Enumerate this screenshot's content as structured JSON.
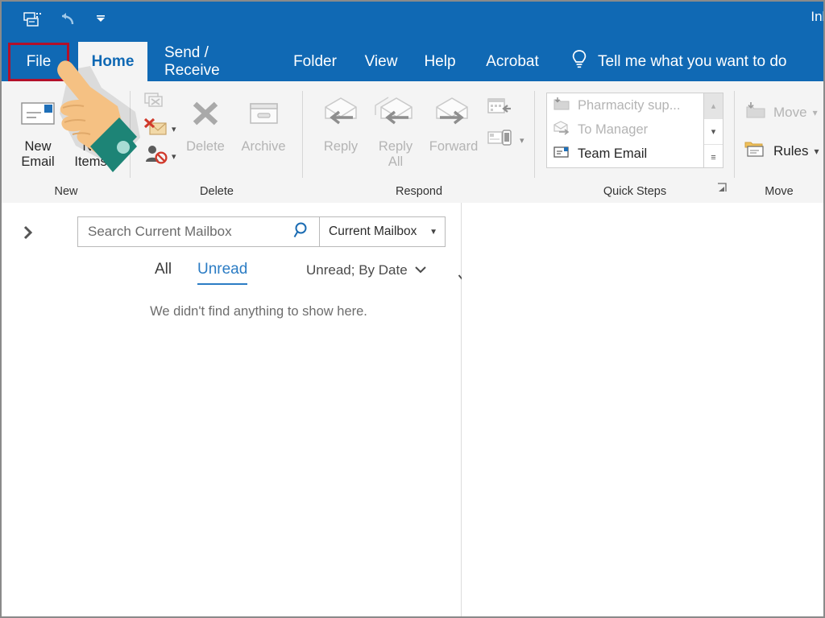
{
  "window": {
    "title": "Inb",
    "accent_color": "#1069b4",
    "highlight_color": "#b3102a"
  },
  "quick_access_toolbar": {
    "items": [
      {
        "name": "send-receive-all-folders",
        "tooltip": "Send/Receive All Folders"
      },
      {
        "name": "undo",
        "tooltip": "Undo"
      },
      {
        "name": "customize-quick-access-toolbar",
        "tooltip": "Customize Quick Access Toolbar"
      }
    ]
  },
  "tabs": [
    {
      "label": "File",
      "active": false
    },
    {
      "label": "Home",
      "active": true
    },
    {
      "label": "Send / Receive",
      "active": false
    },
    {
      "label": "Folder",
      "active": false
    },
    {
      "label": "View",
      "active": false
    },
    {
      "label": "Help",
      "active": false
    },
    {
      "label": "Acrobat",
      "active": false
    }
  ],
  "tell_me": {
    "label": "Tell me what you want to do",
    "icon": "lightbulb-icon"
  },
  "ribbon": {
    "groups": [
      {
        "label": "New",
        "buttons": [
          {
            "label_line1": "New",
            "label_line2": "Email",
            "icon": "new-email-icon",
            "disabled": false
          },
          {
            "label_line1": "New",
            "label_line2": "Items",
            "icon": "new-items-icon",
            "disabled": false,
            "has_dropdown": true
          }
        ]
      },
      {
        "label": "Delete",
        "small_buttons": [
          {
            "name": "ignore",
            "icon": "ignore-icon",
            "disabled": true
          },
          {
            "name": "junk",
            "icon": "junk-envelope-icon",
            "disabled": false,
            "has_dropdown": true
          },
          {
            "name": "block-sender",
            "icon": "block-sender-icon",
            "disabled": false,
            "has_dropdown": true
          }
        ],
        "buttons": [
          {
            "label_line1": "Delete",
            "label_line2": "",
            "icon": "delete-x-icon",
            "disabled": true
          },
          {
            "label_line1": "Archive",
            "label_line2": "",
            "icon": "archive-box-icon",
            "disabled": true
          }
        ]
      },
      {
        "label": "Respond",
        "buttons": [
          {
            "label_line1": "Reply",
            "label_line2": "",
            "icon": "reply-icon",
            "disabled": true
          },
          {
            "label_line1": "Reply",
            "label_line2": "All",
            "icon": "reply-all-icon",
            "disabled": true
          },
          {
            "label_line1": "Forward",
            "label_line2": "",
            "icon": "forward-icon",
            "disabled": true
          }
        ],
        "small_buttons": [
          {
            "name": "meeting",
            "icon": "meeting-icon",
            "disabled": true
          },
          {
            "name": "more-respond",
            "icon": "reply-device-icon",
            "disabled": true,
            "has_dropdown": true
          }
        ]
      },
      {
        "label": "Quick Steps",
        "gallery": [
          {
            "label": "Pharmacity sup...",
            "icon": "move-to-folder-icon",
            "disabled": true
          },
          {
            "label": "To Manager",
            "icon": "to-manager-icon",
            "disabled": true
          },
          {
            "label": "Team Email",
            "icon": "team-email-icon",
            "disabled": false
          }
        ],
        "scroll_buttons": [
          {
            "name": "scroll-up",
            "glyph": "▴",
            "disabled": true
          },
          {
            "name": "scroll-down",
            "glyph": "▾",
            "disabled": false
          },
          {
            "name": "more-quick-steps",
            "glyph": "≡",
            "disabled": false
          }
        ],
        "has_dialog_launcher": true
      },
      {
        "label": "Move",
        "small_buttons": [
          {
            "label": "Move",
            "icon": "move-folder-icon",
            "disabled": true,
            "has_dropdown": true
          },
          {
            "label": "Rules",
            "icon": "rules-icon",
            "disabled": false,
            "has_dropdown": true
          }
        ]
      }
    ]
  },
  "navigation_pane": {
    "expand_icon": "chevron-right-icon",
    "collapsed": true
  },
  "search": {
    "value": "",
    "placeholder": "Search Current Mailbox",
    "icon": "search-icon",
    "scope": "Current Mailbox",
    "scope_icon": "chevron-down-icon"
  },
  "message_list": {
    "filters": [
      {
        "label": "All",
        "selected": false
      },
      {
        "label": "Unread",
        "selected": true
      }
    ],
    "sort": {
      "label": "Unread; By Date",
      "icon": "chevron-down-icon"
    },
    "sort_direction_icon": "arrow-down-icon",
    "empty_message": "We didn't find anything to show here."
  },
  "cursor_overlay": {
    "type": "pointing-hand",
    "skin_color": "#f5c183",
    "sleeve_color": "#1d8476"
  }
}
